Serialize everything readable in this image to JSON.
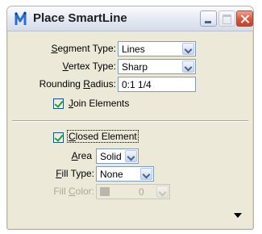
{
  "window": {
    "title": "Place SmartLine",
    "icon": "smartline-tool-icon",
    "controls": [
      "minimize-icon",
      "maximize-icon",
      "close-icon"
    ]
  },
  "segment_type": {
    "label_u": "S",
    "label_rest": "egment Type:",
    "value": "Lines"
  },
  "vertex_type": {
    "label_u": "V",
    "label_rest": "ertex Type:",
    "value": "Sharp"
  },
  "rounding_radius": {
    "label_pre": "Rounding ",
    "label_u": "R",
    "label_rest": "adius:",
    "value": "0:1 1/4"
  },
  "join_elements": {
    "label_u": "J",
    "label_rest": "oin Elements",
    "checked": true
  },
  "closed_element": {
    "label_u": "C",
    "label_rest": "losed Element",
    "checked": true
  },
  "area": {
    "label_u": "A",
    "label_rest": "rea",
    "value": "Solid"
  },
  "fill_type": {
    "label_u": "F",
    "label_rest": "ill Type:",
    "value": "None"
  },
  "fill_color": {
    "label_pre": "Fill ",
    "label_u": "C",
    "label_rest": "olor:",
    "value": "0",
    "enabled": false
  },
  "colors": {
    "accent_check": "#21a121",
    "border": "#7f9db9",
    "close": "#d9553b"
  }
}
